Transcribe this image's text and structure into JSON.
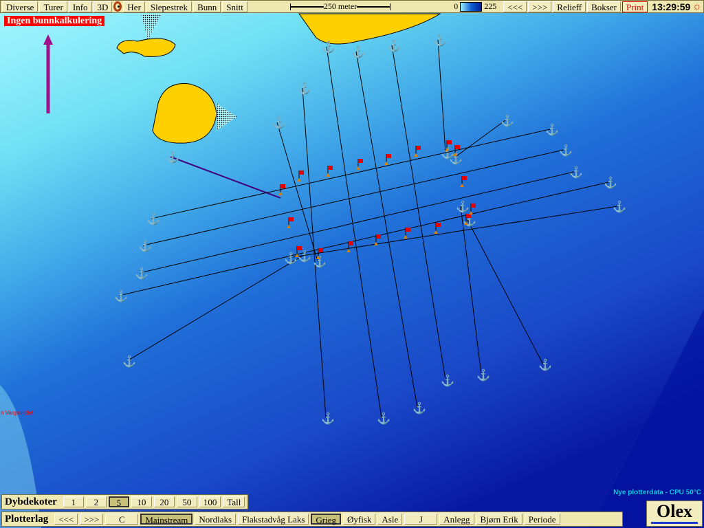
{
  "toolbar": {
    "items": [
      "Diverse",
      "Turer",
      "Info",
      "3D"
    ],
    "her": "Her",
    "items2": [
      "Slepestrek",
      "Bunn",
      "Snitt"
    ],
    "scale": "250 meter",
    "depth_min": "0",
    "depth_max": "225",
    "prev": "<<<",
    "next": ">>>",
    "relieff": "Relieff",
    "bokser": "Bokser",
    "print": "Print",
    "time": "13:29:59"
  },
  "warning": "Ingen bunnkalkulering",
  "place_label": "n Vargsundet",
  "dybdekoter": {
    "label": "Dybdekoter",
    "options": [
      "1",
      "2",
      "5",
      "10",
      "20",
      "50",
      "100",
      "Tall"
    ],
    "selected": "5"
  },
  "plotterlag": {
    "label": "Plotterlag",
    "layers": [
      "<<<",
      ">>>",
      "C",
      "Mainstream",
      "Nordlaks",
      "Flakstadvåg Laks",
      "Grieg",
      "Øyfisk",
      "Asle",
      "J",
      "Anlegg",
      "Bjørn Erik",
      "Periode"
    ],
    "selected": [
      "Mainstream",
      "Grieg"
    ]
  },
  "status": "Nye plotterdata - CPU 50°C",
  "logo": "Olex",
  "colors": {
    "land": "#ffd000",
    "shallow": "#a0f8ff",
    "deep": "#0010a0",
    "warning": "#ff0000",
    "toolbar": "#eee8b0"
  }
}
